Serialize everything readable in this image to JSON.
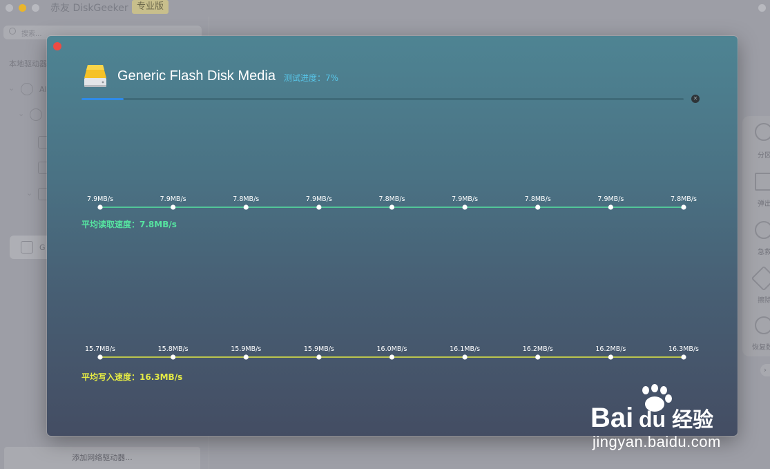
{
  "app": {
    "title": "赤友 DiskGeeker",
    "badge": "专业版",
    "search_placeholder": "搜索...",
    "sidebar_section": "本地驱动器",
    "tree_item_a": "Al",
    "tree_item_sel": "G",
    "add_network_drive": "添加网络驱动器...",
    "toolbar": [
      "分区",
      "弹出",
      "急救",
      "擦除",
      "恢复数"
    ]
  },
  "dialog": {
    "device_name": "Generic Flash Disk Media",
    "progress_label": "测试进度：7%",
    "progress": 0.07,
    "read": {
      "values": [
        "7.9MB/s",
        "7.9MB/s",
        "7.8MB/s",
        "7.9MB/s",
        "7.8MB/s",
        "7.9MB/s",
        "7.8MB/s",
        "7.9MB/s",
        "7.8MB/s"
      ],
      "average_label": "平均读取速度：7.8MB/s",
      "color": "#56e3a0"
    },
    "write": {
      "values": [
        "15.7MB/s",
        "15.8MB/s",
        "15.9MB/s",
        "15.9MB/s",
        "16.0MB/s",
        "16.1MB/s",
        "16.2MB/s",
        "16.2MB/s",
        "16.3MB/s"
      ],
      "average_label": "平均写入速度：16.3MB/s",
      "color": "#e4ea44"
    }
  },
  "watermark": {
    "logo": "Bai du 经验",
    "url": "jingyan.baidu.com"
  }
}
